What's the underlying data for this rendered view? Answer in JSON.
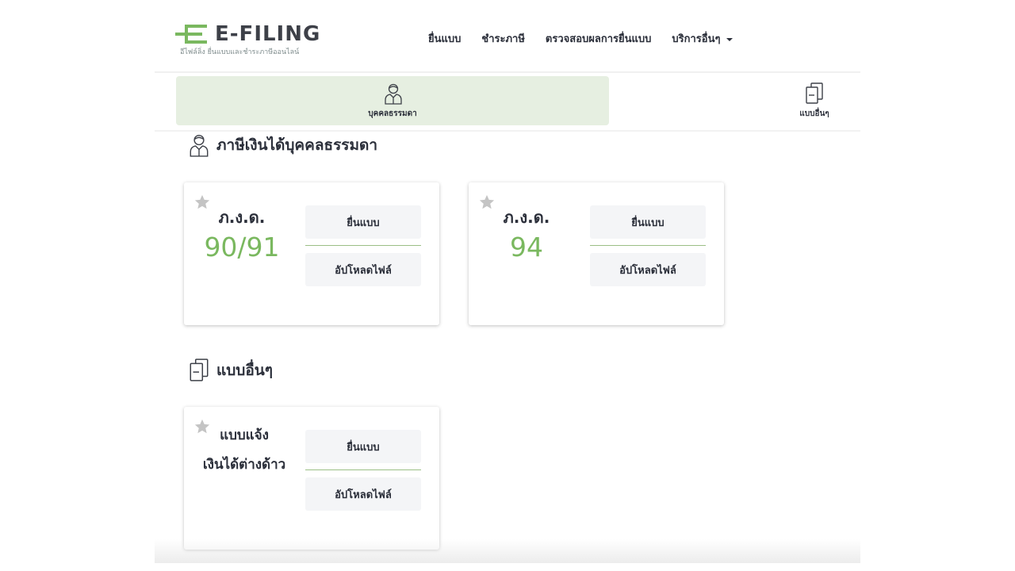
{
  "header": {
    "logo_text": "E-FILING",
    "logo_subtitle": "อีไฟล์ลิ่ง ยื่นแบบและชำระภาษีออนไลน์",
    "brand_color": "#7ab85f",
    "nav": [
      {
        "label": "ยื่นแบบ"
      },
      {
        "label": "ชำระภาษี"
      },
      {
        "label": "ตรวจสอบผลการยื่นแบบ"
      },
      {
        "label": "บริการอื่นๆ",
        "has_dropdown": true
      }
    ]
  },
  "tabs": [
    {
      "label": "บุคคลธรรมดา",
      "icon": "person-icon",
      "active": true
    },
    {
      "label": "แบบอื่นๆ",
      "icon": "documents-icon",
      "active": false
    }
  ],
  "sections": [
    {
      "title": "ภาษีเงินได้บุคคลธรรมดา",
      "icon": "person-icon",
      "cards": [
        {
          "code": "ภ.ง.ด.",
          "number": "90/91",
          "file_label": "ยื่นแบบ",
          "upload_label": "อัปโหลดไฟล์"
        },
        {
          "code": "ภ.ง.ด.",
          "number": "94",
          "file_label": "ยื่นแบบ",
          "upload_label": "อัปโหลดไฟล์"
        }
      ]
    },
    {
      "title": "แบบอื่นๆ",
      "icon": "documents-icon",
      "cards": [
        {
          "name_line1": "แบบแจ้ง",
          "name_line2": "เงินได้ต่างด้าว",
          "file_label": "ยื่นแบบ",
          "upload_label": "อัปโหลดไฟล์"
        }
      ]
    }
  ],
  "colors": {
    "accent_green": "#7ab85f",
    "tab_active_bg": "#e6efe1",
    "button_bg": "#f4f5f7",
    "star": "#c4c4c4",
    "text": "#2b2f3a"
  }
}
